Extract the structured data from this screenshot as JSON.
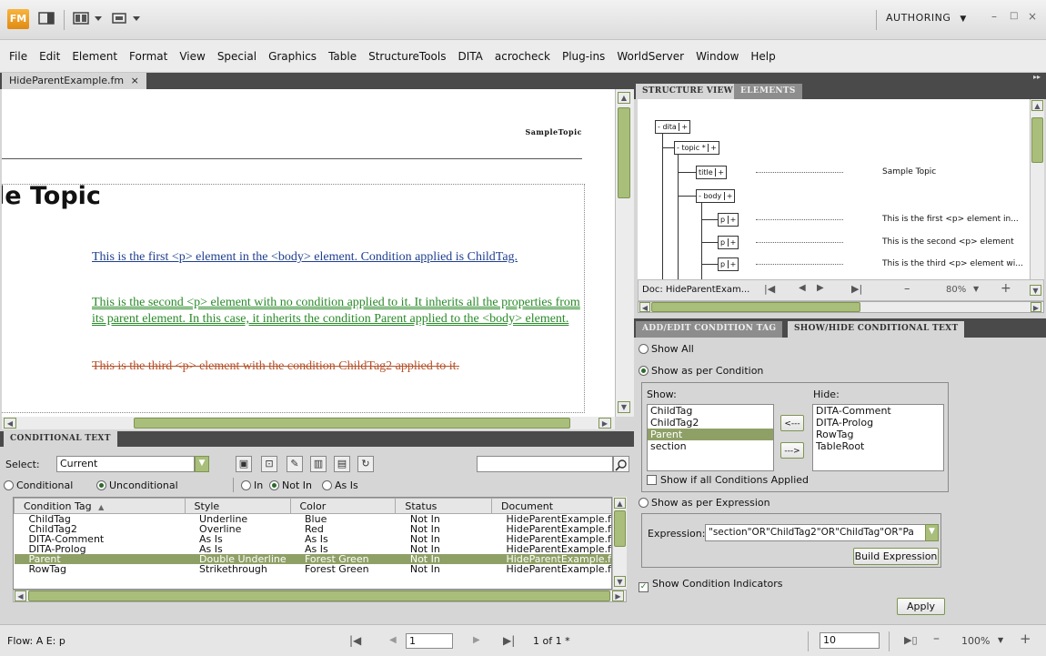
{
  "app": {
    "logo": "FM",
    "workspace": "AUTHORING",
    "workspace_arrow": "▼"
  },
  "window_controls": {
    "minimize": "–",
    "maximize": "□",
    "close": "×"
  },
  "menu": [
    "File",
    "Edit",
    "Element",
    "Format",
    "View",
    "Special",
    "Graphics",
    "Table",
    "StructureTools",
    "DITA",
    "acrocheck",
    "Plug-ins",
    "WorldServer",
    "Window",
    "Help"
  ],
  "document": {
    "tab_label": "HideParentExample.fm",
    "tab_close": "×",
    "header_text": "SampleTopic",
    "title": "le Topic",
    "paragraphs": [
      "This is the first <p> element in the <body> element. Condition applied is ChildTag.",
      "This is the second <p> element with no condition applied to it. It inherits all the properties from its parent element. In this case, it inherits the condition Parent applied to the <body> element.",
      "This is the third <p> element with the condition ChildTag2 applied to it."
    ]
  },
  "conditional_text": {
    "tab": "CONDITIONAL TEXT",
    "select_label": "Select:",
    "select_value": "Current",
    "radio_conditional": "Conditional",
    "radio_unconditional": "Unconditional",
    "radio_in": "In",
    "radio_not_in": "Not In",
    "radio_as_is": "As Is",
    "columns": [
      "Condition Tag",
      "Style",
      "Color",
      "Status",
      "Document"
    ],
    "rows": [
      [
        "ChildTag",
        "Underline",
        "Blue",
        "Not In",
        "HideParentExample.fm"
      ],
      [
        "ChildTag2",
        "Overline",
        "Red",
        "Not In",
        "HideParentExample.fm"
      ],
      [
        "DITA-Comment",
        "As Is",
        "As Is",
        "Not In",
        "HideParentExample.fm"
      ],
      [
        "DITA-Prolog",
        "As Is",
        "As Is",
        "Not In",
        "HideParentExample.fm"
      ],
      [
        "Parent",
        "Double Underline",
        "Forest Green",
        "Not In",
        "HideParentExample.fm"
      ],
      [
        "RowTag",
        "Strikethrough",
        "Forest Green",
        "Not In",
        "HideParentExample.fm"
      ]
    ],
    "selected_row": 4
  },
  "structure": {
    "tab_active": "STRUCTURE VIEW",
    "tab_inactive": "ELEMENTS",
    "nodes": {
      "dita": "dita",
      "topic": "topic *",
      "title": "title",
      "body": "body",
      "p": "p"
    },
    "texts": [
      "Sample Topic",
      "This is the first <p> element in...",
      "This is the second <p> element",
      "This is the third <p> element wi..."
    ],
    "doc_label": "Doc: HideParentExam...",
    "zoom": "80%"
  },
  "showhide": {
    "tab_inactive": "ADD/EDIT CONDITION TAG",
    "tab_active": "SHOW/HIDE CONDITIONAL TEXT",
    "show_all": "Show All",
    "show_per_condition": "Show as per Condition",
    "show_label": "Show:",
    "hide_label": "Hide:",
    "show_list": [
      "ChildTag",
      "ChildTag2",
      "Parent",
      "section"
    ],
    "hide_list": [
      "DITA-Comment",
      "DITA-Prolog",
      "RowTag",
      "TableRoot"
    ],
    "move_left": "<---",
    "move_right": "--->",
    "show_if_all": "Show if all Conditions Applied",
    "show_per_expression": "Show as per Expression",
    "expression_label": "Expression:",
    "expression_value": "\"section\"OR\"ChildTag2\"OR\"ChildTag\"OR\"Pa",
    "build_expression": "Build Expression",
    "show_indicators": "Show Condition Indicators",
    "apply": "Apply"
  },
  "status": {
    "flow": "Flow: A  E: p",
    "page_value": "1",
    "page_of": "1 of 1 *",
    "field_value": "10",
    "zoom": "100%",
    "plus": "+",
    "minus": "–"
  }
}
